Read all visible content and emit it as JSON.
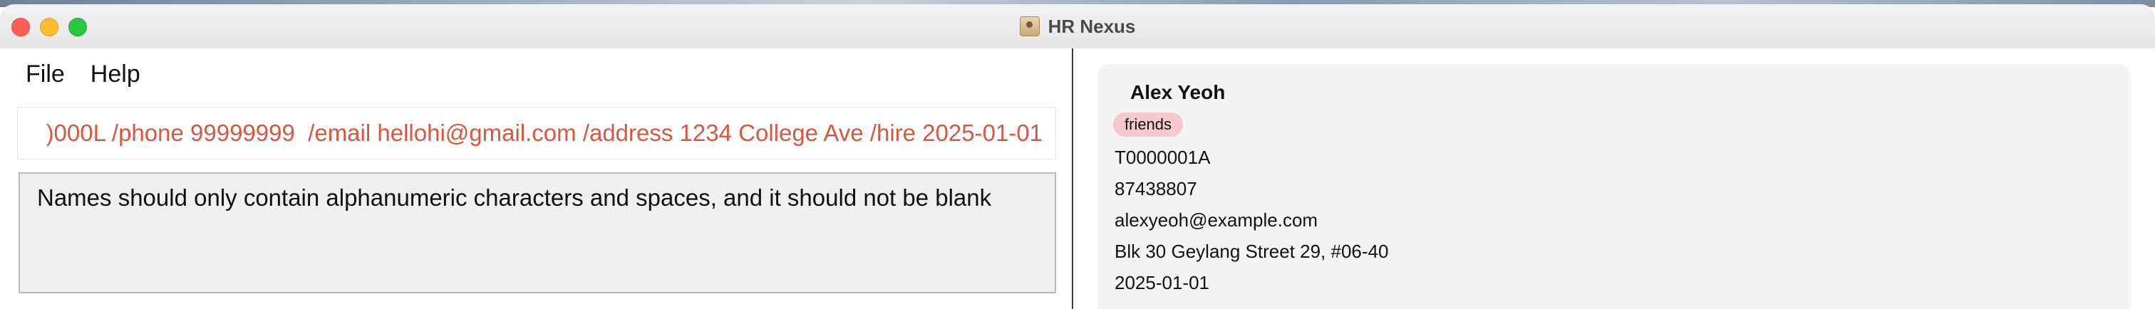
{
  "window": {
    "title": "HR Nexus"
  },
  "menu": {
    "items": [
      "File",
      "Help"
    ]
  },
  "command": {
    "value": ")000L /phone 99999999  /email hellohi@gmail.com /address 1234 College Ave /hire 2025-01-01"
  },
  "result": {
    "message": "Names should only contain alphanumeric characters and spaces, and it should not be blank"
  },
  "person": {
    "name": "Alex Yeoh",
    "tags": [
      "friends"
    ],
    "id": "T0000001A",
    "phone": "87438807",
    "email": "alexyeoh@example.com",
    "address": "Blk 30 Geylang Street 29, #06-40",
    "hire_date": "2025-01-01"
  },
  "colors": {
    "command_text": "#d9573f",
    "tag_bg": "#f6c9cd",
    "card_bg": "#f3f3f3"
  }
}
